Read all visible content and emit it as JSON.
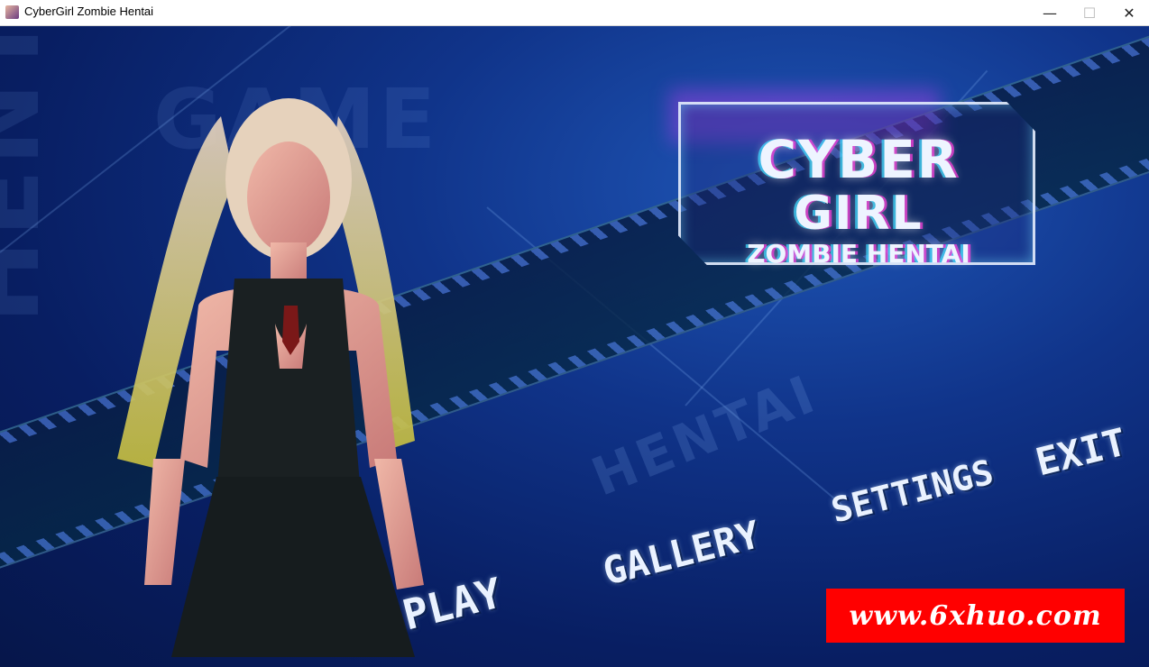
{
  "window": {
    "title": "CyberGirl Zombie Hentai",
    "controls": {
      "minimize": "—",
      "maximize": "☐",
      "close": "✕"
    }
  },
  "logo": {
    "line1": "CYBER",
    "line2": "GIRL",
    "line3": "ZOMBIE HENTAI"
  },
  "background_text": {
    "game": "GAME",
    "hentai_vertical": "HENTAI",
    "hentai_mid": "HENTAI"
  },
  "menu": {
    "play": "PLAY",
    "gallery": "GALLERY",
    "settings": "SETTINGS",
    "exit": "EXIT"
  },
  "watermark": {
    "text": "www.6xhuo.com"
  },
  "colors": {
    "background": "#10348a",
    "accent_magenta": "#ff3cdc",
    "accent_cyan": "#3cdcff",
    "watermark_red": "#ff0000"
  },
  "icons": [
    "app-icon",
    "minimize-icon",
    "maximize-icon",
    "close-icon"
  ]
}
